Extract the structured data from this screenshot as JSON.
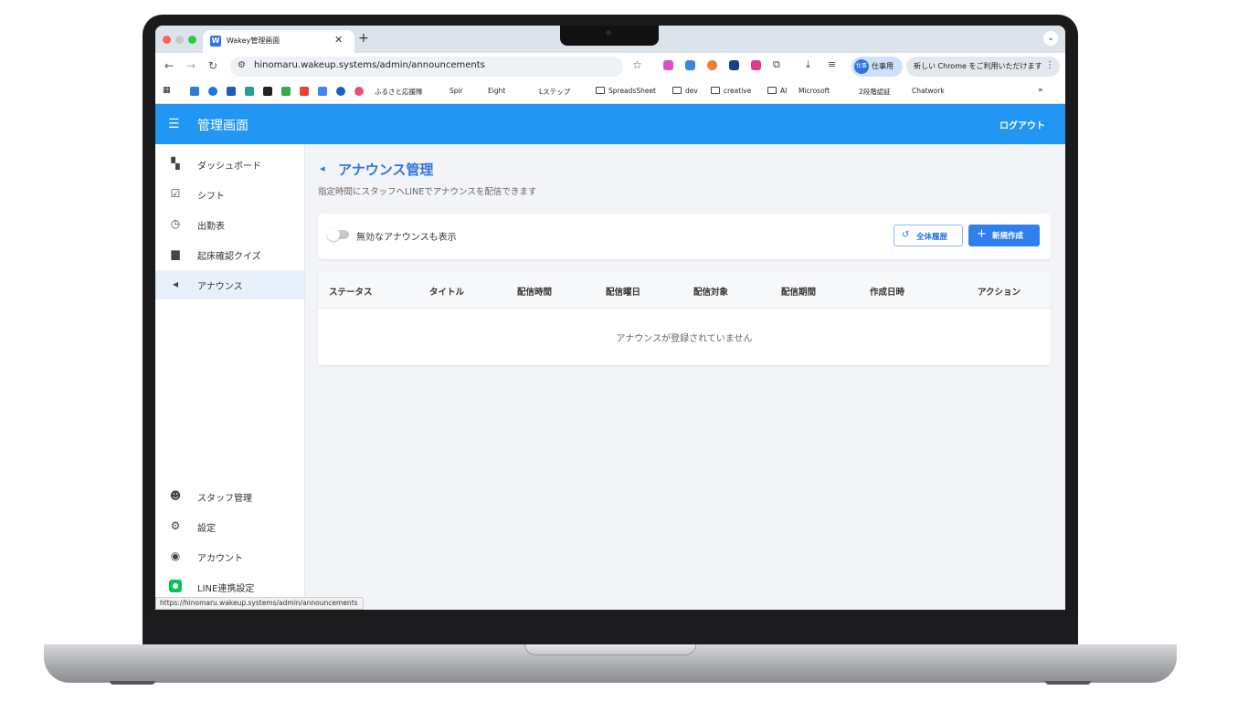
{
  "browser": {
    "tab_title": "Wakey管理画面",
    "tab_favicon": "W",
    "url": "hinomaru.wakeup.systems/admin/announcements",
    "profile_label": "仕事用",
    "profile_avatar": "仕事",
    "update_label": "新しい Chrome をご利用いただけます",
    "status_url": "https://hinomaru.wakeup.systems/admin/announcements",
    "bookmarks": [
      "ふるさと応援隊",
      "Spir",
      "Eight",
      "Lステップ",
      "SpreadsSheet",
      "dev",
      "creative",
      "AI",
      "Microsoft",
      "2段階認証",
      "Chatwork"
    ],
    "more_bookmarks": "»"
  },
  "header": {
    "title": "管理画面",
    "logout": "ログアウト"
  },
  "sidebar": {
    "items": [
      {
        "label": "ダッシュボード",
        "icon": "dashboard-icon"
      },
      {
        "label": "シフト",
        "icon": "calendar-check-icon"
      },
      {
        "label": "出勤表",
        "icon": "clock-icon"
      },
      {
        "label": "起床確認クイズ",
        "icon": "chat-icon"
      },
      {
        "label": "アナウンス",
        "icon": "megaphone-icon"
      }
    ],
    "bottom_items": [
      {
        "label": "スタッフ管理",
        "icon": "people-icon"
      },
      {
        "label": "設定",
        "icon": "gear-icon"
      },
      {
        "label": "アカウント",
        "icon": "account-icon"
      },
      {
        "label": "LINE連携設定",
        "icon": "line-icon"
      }
    ]
  },
  "page": {
    "title": "アナウンス管理",
    "subtitle": "指定時間にスタッフへLINEでアナウンスを配信できます",
    "toggle_label": "無効なアナウンスも表示",
    "history_button": "全体履歴",
    "create_button": "新規作成"
  },
  "table": {
    "columns": [
      "ステータス",
      "タイトル",
      "配信時間",
      "配信曜日",
      "配信対象",
      "配信期間",
      "作成日時",
      "アクション"
    ],
    "empty_message": "アナウンスが登録されていません"
  },
  "colors": {
    "primary": "#2196f3",
    "accent": "#2f74e0"
  }
}
